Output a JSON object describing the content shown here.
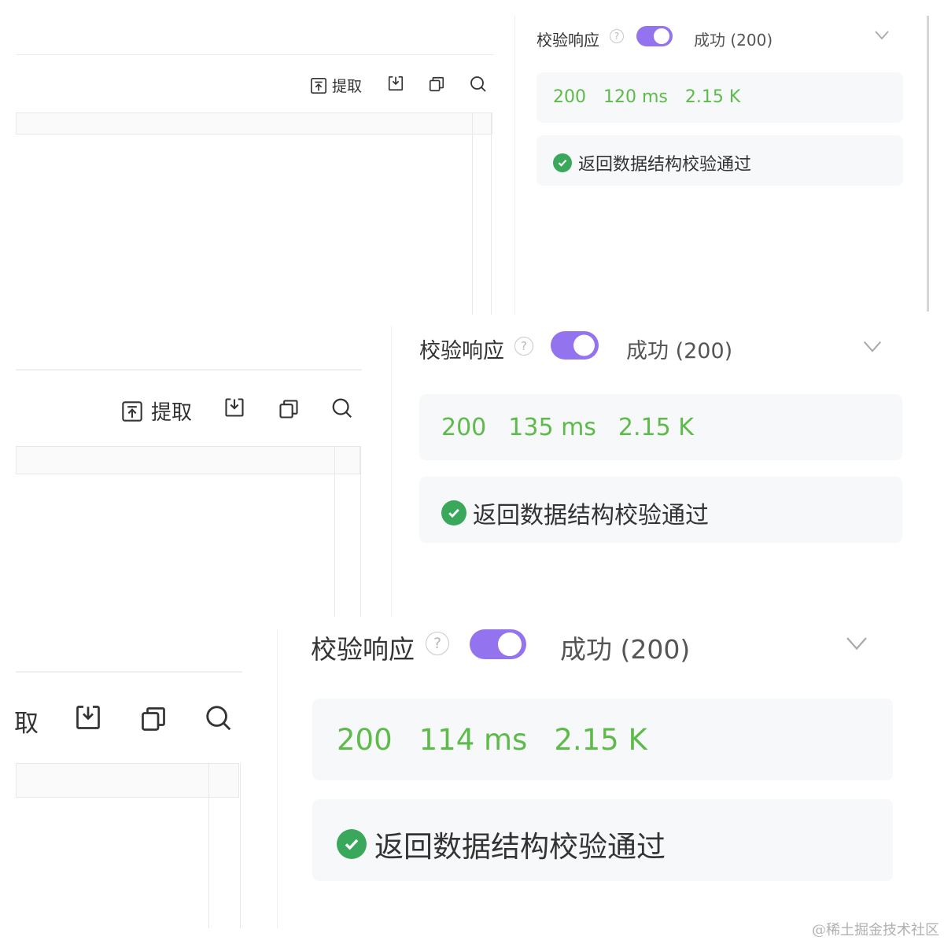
{
  "toolbar": {
    "extract_label": "提取",
    "extract_label_cropped": "取",
    "extract_icon": "extract-icon",
    "import_icon": "download-icon",
    "copy_icon": "copy-icon",
    "search_icon": "search-icon"
  },
  "response": {
    "validate_label": "校验响应",
    "help_icon": "question-circle-icon",
    "toggle_on": true,
    "status_label": "成功 (200)",
    "collapse_icon": "chevron-down-icon",
    "validation_message": "返回数据结构校验通过",
    "check_icon": "check-circle-icon"
  },
  "snapshots": [
    {
      "status_code": "200",
      "time": "120 ms",
      "size": "2.15 K"
    },
    {
      "status_code": "200",
      "time": "135 ms",
      "size": "2.15 K"
    },
    {
      "status_code": "200",
      "time": "114 ms",
      "size": "2.15 K"
    }
  ],
  "colors": {
    "accent": "#9373ee",
    "success_text": "#5dbb49",
    "check_green": "#3aa85a",
    "card_bg": "#f7f8fa"
  },
  "watermark": "@稀土掘金技术社区"
}
